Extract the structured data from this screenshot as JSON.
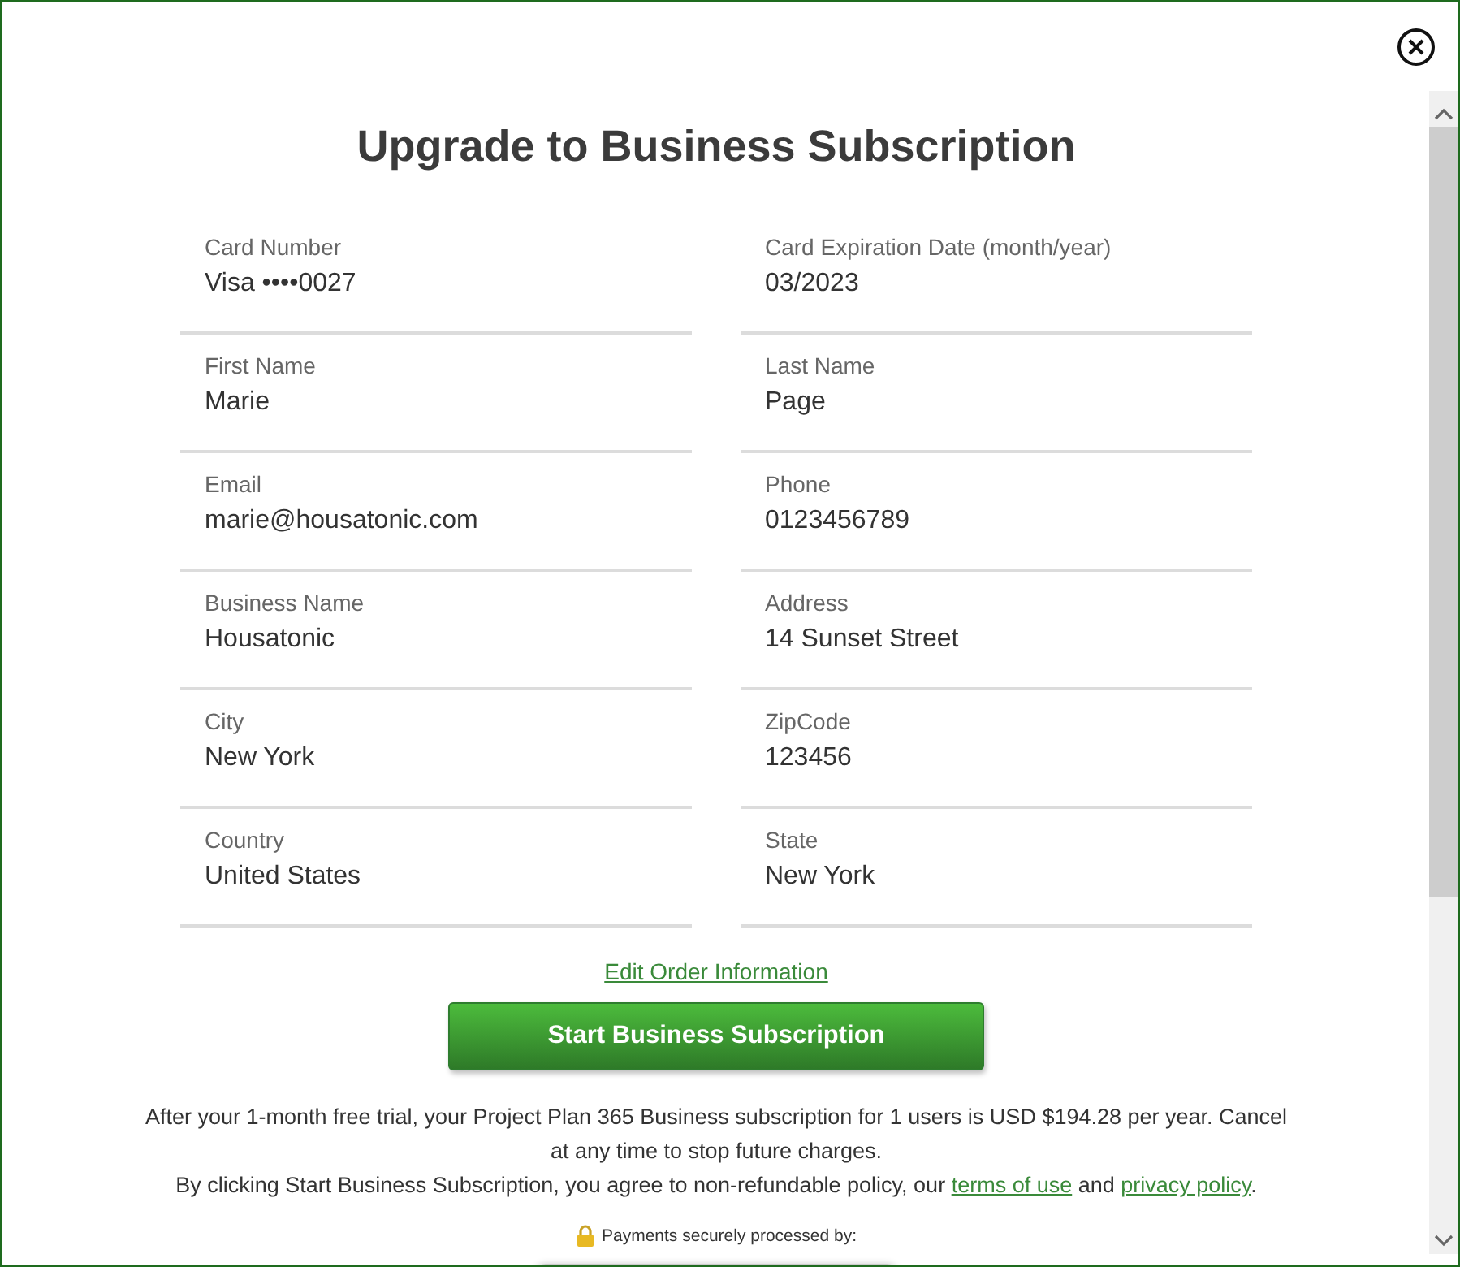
{
  "title": "Upgrade to Business Subscription",
  "fields": [
    {
      "label": "Card Number",
      "value": "Visa ••••0027"
    },
    {
      "label": "Card Expiration Date (month/year)",
      "value": "03/2023"
    },
    {
      "label": "First Name",
      "value": "Marie"
    },
    {
      "label": "Last Name",
      "value": "Page"
    },
    {
      "label": "Email",
      "value": "marie@housatonic.com"
    },
    {
      "label": "Phone",
      "value": "0123456789"
    },
    {
      "label": "Business Name",
      "value": "Housatonic"
    },
    {
      "label": "Address",
      "value": "14 Sunset Street"
    },
    {
      "label": "City",
      "value": "New York"
    },
    {
      "label": "ZipCode",
      "value": "123456"
    },
    {
      "label": "Country",
      "value": "United States"
    },
    {
      "label": "State",
      "value": "New York"
    }
  ],
  "edit_link": "Edit Order Information",
  "submit_button": "Start Business Subscription",
  "notice": "After your 1-month free trial, your Project Plan 365 Business subscription for 1 users is USD $194.28 per year. Cancel at any time to stop future charges.",
  "agreement": {
    "text": "By clicking Start Business Subscription, you agree to non-refundable policy, our",
    "terms_link": "terms of use",
    "joiner": "and",
    "privacy_link": "privacy policy",
    "end": "."
  },
  "payments_note": "Payments securely processed by:"
}
